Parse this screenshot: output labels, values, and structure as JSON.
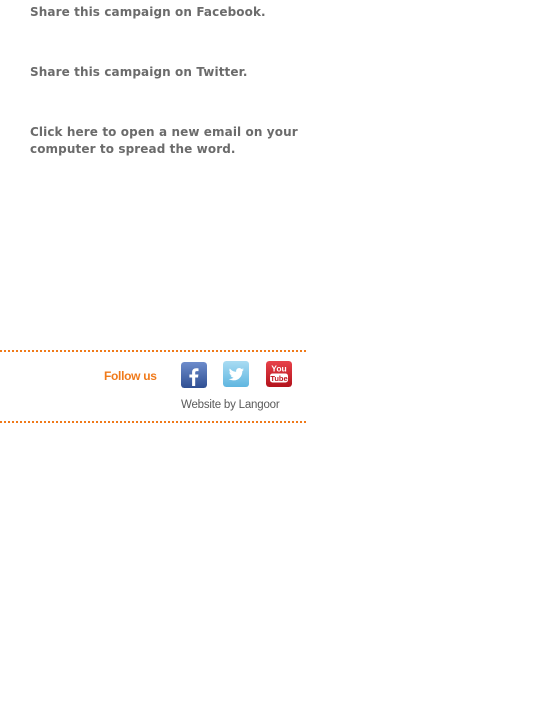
{
  "share": {
    "facebook_text": "Share this campaign on Facebook.",
    "twitter_text": "Share this campaign on Twitter.",
    "email_text": "Click here to open a new email on your computer to spread the word."
  },
  "footer": {
    "follow_label": "Follow us",
    "social_icons": [
      "facebook-icon",
      "twitter-icon",
      "youtube-icon"
    ],
    "credit_text": "Website by Langoor"
  },
  "colors": {
    "text_gray": "#6b6b6b",
    "accent_orange": "#f07a1a",
    "facebook_blue": "#3b5998",
    "twitter_blue": "#7cc5e8",
    "youtube_red": "#d21f28"
  }
}
